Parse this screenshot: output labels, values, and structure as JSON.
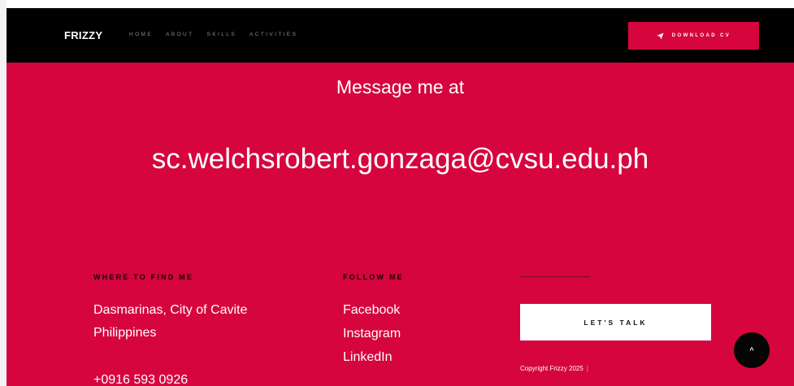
{
  "navbar": {
    "brand": "FRIZZY",
    "links": [
      "HOME",
      "ABOUT",
      "SKILLS",
      "ACTIVITIES"
    ],
    "cv_button": "DOWNLOAD CV",
    "cv_icon": "paper-plane-icon"
  },
  "hero": {
    "message": "Message me at",
    "email": "sc.welchsrobert.gonzaga@cvsu.edu.ph"
  },
  "footer": {
    "where_heading": "WHERE TO FIND ME",
    "address_line1": "Dasmarinas, City of Cavite",
    "address_line2": "Philippines",
    "phone": "+0916 593 0926",
    "follow_heading": "FOLLOW ME",
    "social": [
      "Facebook",
      "Instagram",
      "LinkedIn"
    ],
    "talk_button": "LET'S TALK",
    "copyright": "Copyright Frizzy 2025",
    "separator": "|"
  },
  "back_to_top": {
    "glyph": "^",
    "icon": "chevron-up-icon"
  },
  "colors": {
    "accent": "#d6053e",
    "nav_bg": "#000000",
    "text": "#ffffff"
  }
}
